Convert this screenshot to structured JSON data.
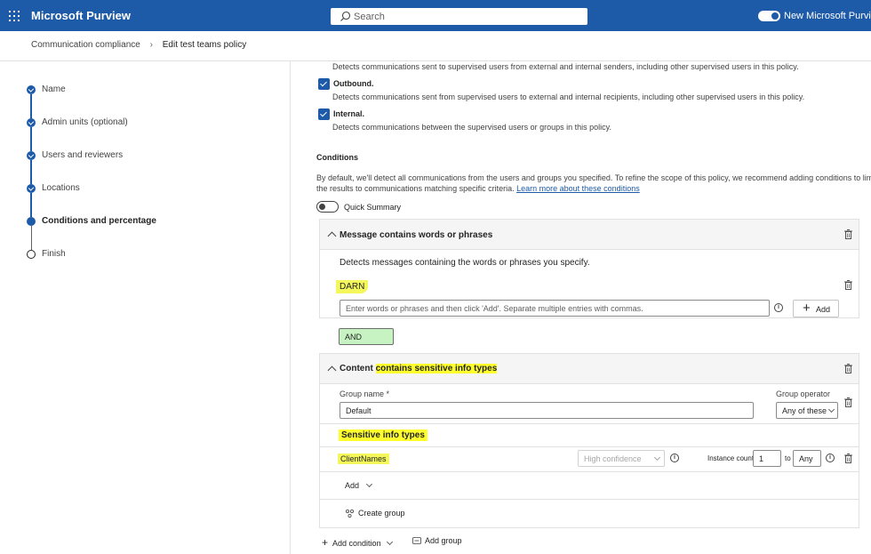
{
  "topbar": {
    "app_title": "Microsoft Purview",
    "search_placeholder": "Search",
    "new_purview_label": "New Microsoft Purview po"
  },
  "breadcrumb": {
    "parent": "Communication compliance",
    "current": "Edit test teams policy"
  },
  "steps": [
    {
      "label": "Name",
      "state": "done"
    },
    {
      "label": "Admin units (optional)",
      "state": "done"
    },
    {
      "label": "Users and reviewers",
      "state": "done"
    },
    {
      "label": "Locations",
      "state": "done"
    },
    {
      "label": "Conditions and percentage",
      "state": "current"
    },
    {
      "label": "Finish",
      "state": "pending"
    }
  ],
  "direction": {
    "inbound_desc": "Detects communications sent to supervised users from external and internal senders, including other supervised users in this policy.",
    "outbound_label": "Outbound.",
    "outbound_desc": "Detects communications sent from supervised users to external and internal recipients, including other supervised users in this policy.",
    "internal_label": "Internal.",
    "internal_desc": "Detects communications between the supervised users or groups in this policy."
  },
  "conditions": {
    "heading": "Conditions",
    "desc_line1": "By default, we'll detect all communications from the users and groups you specified. To refine the scope of this policy, we recommend adding conditions to limit",
    "desc_line2": "the results to communications matching specific criteria.",
    "learn_more": "Learn more about these conditions",
    "quick_summary": "Quick Summary"
  },
  "words_card": {
    "title": "Message contains words or phrases",
    "description": "Detects messages containing the words or phrases you specify.",
    "word": "DARN",
    "input_placeholder": "Enter words or phrases and then click 'Add'. Separate multiple entries with commas.",
    "add_label": "Add",
    "info_glyph": "i"
  },
  "operator": "AND",
  "sit_card": {
    "title_prefix": "Content",
    "title_highlight": "contains sensitive info types",
    "group_name_label": "Group name *",
    "group_name_value": "Default",
    "group_operator_label": "Group operator",
    "group_operator_value": "Any of these",
    "sit_heading": "Sensitive info types",
    "sit_name": "ClientNames",
    "confidence": "High confidence",
    "instance_count_label": "Instance count",
    "instance_min": "1",
    "to_label": "to",
    "instance_max": "Any",
    "add_label": "Add",
    "create_group_label": "Create group"
  },
  "bottom": {
    "add_condition": "Add condition",
    "add_group": "Add group"
  },
  "colors": {
    "topbar": "#1d5aa8",
    "accent": "#1d5aa8",
    "highlight": "#ffff2e",
    "and_fill": "#c7f2c2"
  }
}
